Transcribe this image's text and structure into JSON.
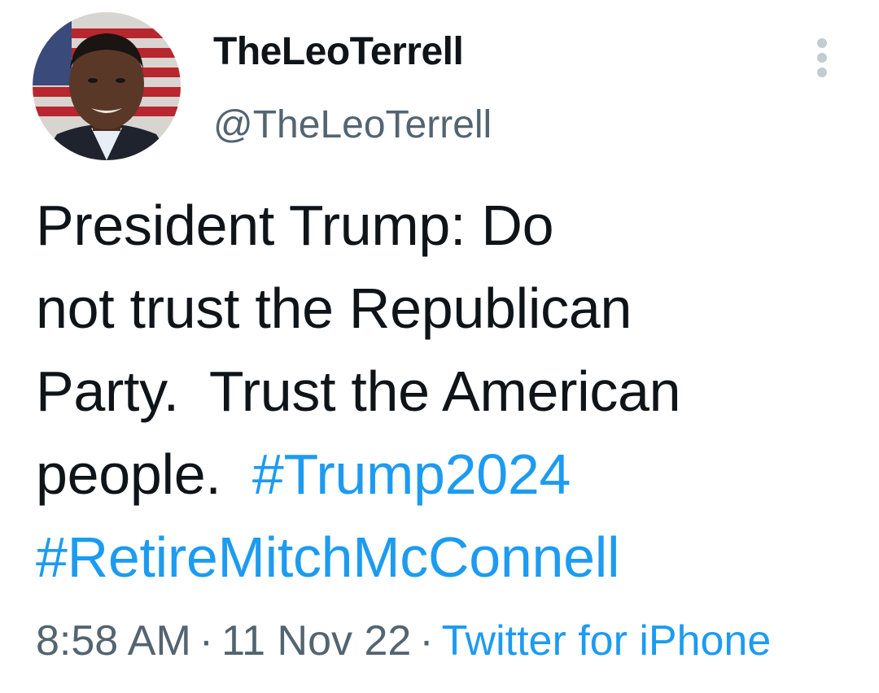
{
  "author": {
    "display_name": "TheLeoTerrell",
    "handle": "@TheLeoTerrell"
  },
  "menu_icon": "more-vertical-icon",
  "tweet": {
    "line1": "President Trump: Do",
    "line2": "not trust the Republican",
    "line3": "Party.  Trust the American",
    "line4_text": "people.  ",
    "hashtag1": "#Trump2024",
    "hashtag2": "#RetireMitchMcConnell"
  },
  "meta": {
    "time": "8:58 AM",
    "separator": "·",
    "date": "11 Nov 22",
    "source": "Twitter for iPhone"
  },
  "colors": {
    "link": "#1d9bf0",
    "secondary_text": "#536471",
    "primary_text": "#0f1419"
  }
}
